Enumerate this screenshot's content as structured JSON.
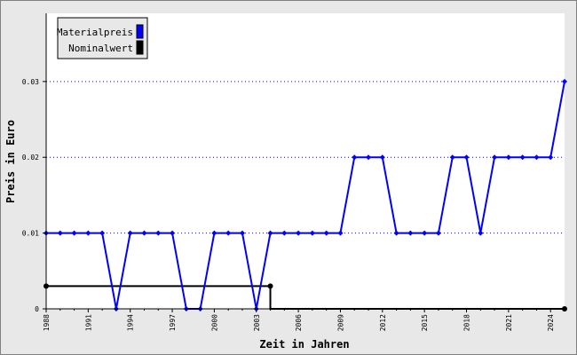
{
  "chart_data": {
    "type": "line",
    "xlabel": "Zeit in Jahren",
    "ylabel": "Preis in Euro",
    "ylim": [
      0,
      0.039
    ],
    "xlim": [
      1988,
      2025
    ],
    "y_ticks": [
      "0",
      "0.01",
      "0.02",
      "0.03"
    ],
    "y_tick_values": [
      0,
      0.01,
      0.02,
      0.03
    ],
    "x_ticks": [
      "1988",
      "1991",
      "1994",
      "1997",
      "2000",
      "2003",
      "2006",
      "2009",
      "2012",
      "2015",
      "2018",
      "2021",
      "2024"
    ],
    "x_tick_values": [
      1988,
      1991,
      1994,
      1997,
      2000,
      2003,
      2006,
      2009,
      2012,
      2015,
      2018,
      2021,
      2024
    ],
    "grid": "horizontal dotted",
    "legend_position": "top-left",
    "series": [
      {
        "name": "Materialpreis",
        "color": "#0000ff",
        "x": [
          1988,
          1989,
          1990,
          1991,
          1992,
          1993,
          1994,
          1995,
          1996,
          1997,
          1998,
          1999,
          2000,
          2001,
          2002,
          2003,
          2004,
          2005,
          2006,
          2007,
          2008,
          2009,
          2010,
          2011,
          2012,
          2013,
          2014,
          2015,
          2016,
          2017,
          2018,
          2019,
          2020,
          2021,
          2022,
          2023,
          2024,
          2025
        ],
        "values": [
          0.01,
          0.01,
          0.01,
          0.01,
          0.01,
          0,
          0.01,
          0.01,
          0.01,
          0.01,
          0,
          0,
          0.01,
          0.01,
          0.01,
          0,
          0.01,
          0.01,
          0.01,
          0.01,
          0.01,
          0.01,
          0.02,
          0.02,
          0.02,
          0.01,
          0.01,
          0.01,
          0.01,
          0.02,
          0.02,
          0.01,
          0.02,
          0.02,
          0.02,
          0.02,
          0.02,
          0.03
        ]
      },
      {
        "name": "Nominalwert",
        "color": "#000000",
        "step": true,
        "x": [
          1988,
          2004,
          2004,
          2025
        ],
        "values": [
          0.003,
          0.003,
          0,
          0
        ],
        "markers_x": [
          2004,
          2025
        ],
        "markers_y": [
          0.003,
          0
        ]
      }
    ]
  }
}
